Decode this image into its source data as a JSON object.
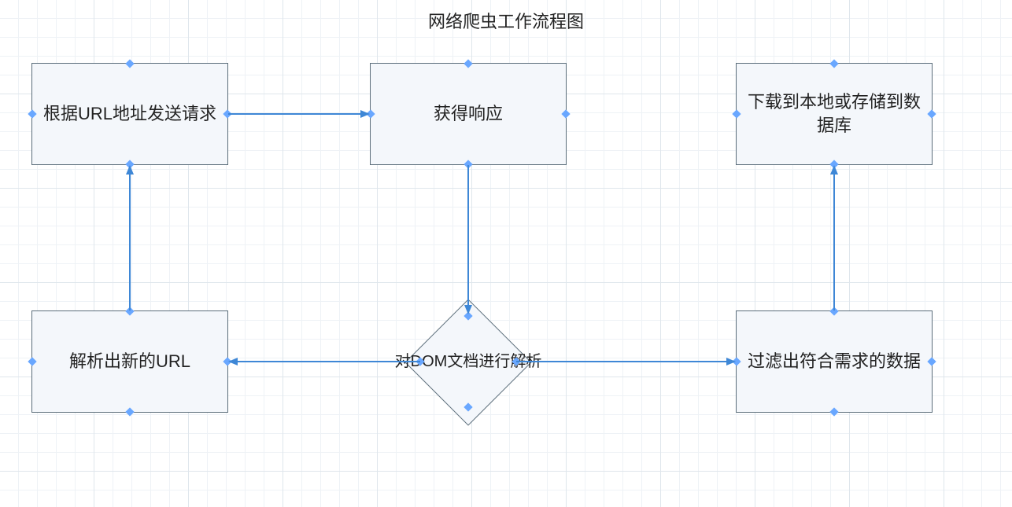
{
  "title": "网络爬虫工作流程图",
  "nodes": {
    "send_request": "根据URL地址发送请求",
    "get_response": "获得响应",
    "download_store": "下载到本地或存储到数据库",
    "parse_url": "解析出新的URL",
    "filter_data": "过滤出符合需求的数据",
    "parse_dom": "对DOM文档进行解析"
  },
  "chart_data": {
    "type": "flowchart",
    "title": "网络爬虫工作流程图",
    "nodes": [
      {
        "id": "send_request",
        "kind": "process",
        "label": "根据URL地址发送请求"
      },
      {
        "id": "get_response",
        "kind": "process",
        "label": "获得响应"
      },
      {
        "id": "parse_dom",
        "kind": "decision",
        "label": "对DOM文档进行解析"
      },
      {
        "id": "parse_url",
        "kind": "process",
        "label": "解析出新的URL"
      },
      {
        "id": "filter_data",
        "kind": "process",
        "label": "过滤出符合需求的数据"
      },
      {
        "id": "download_store",
        "kind": "process",
        "label": "下载到本地或存储到数据库"
      }
    ],
    "edges": [
      {
        "from": "send_request",
        "to": "get_response"
      },
      {
        "from": "get_response",
        "to": "parse_dom"
      },
      {
        "from": "parse_dom",
        "to": "parse_url"
      },
      {
        "from": "parse_dom",
        "to": "filter_data"
      },
      {
        "from": "parse_url",
        "to": "send_request"
      },
      {
        "from": "filter_data",
        "to": "download_store"
      }
    ]
  }
}
